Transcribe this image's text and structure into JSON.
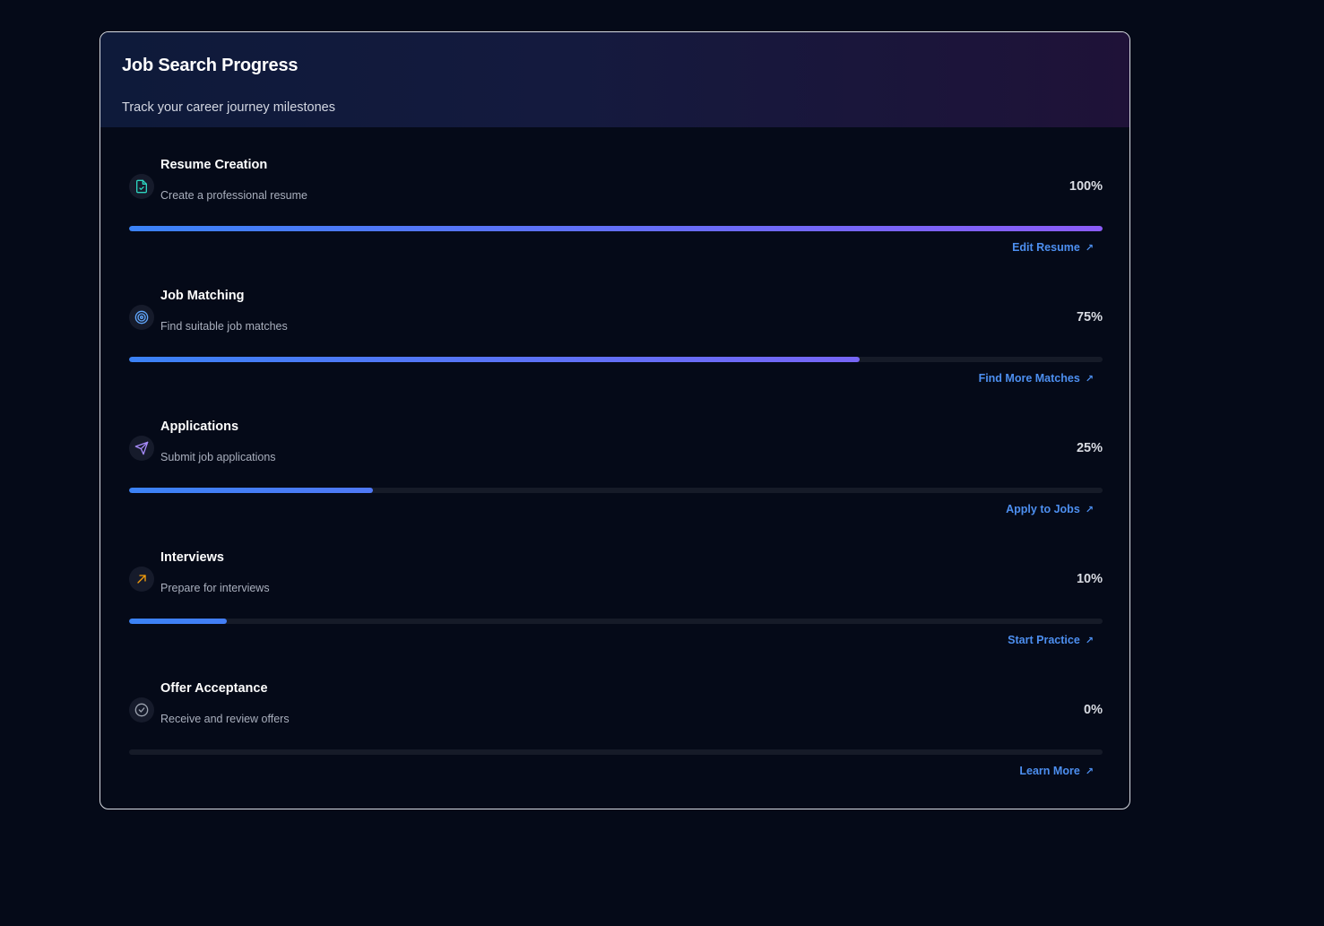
{
  "header": {
    "title": "Job Search Progress",
    "subtitle": "Track your career journey milestones"
  },
  "milestones": [
    {
      "title": "Resume Creation",
      "description": "Create a professional resume",
      "percent_label": "100%",
      "progress": 1.0,
      "action_label": "Edit Resume",
      "icon": "file-check-icon",
      "icon_color": "#2dd4bf"
    },
    {
      "title": "Job Matching",
      "description": "Find suitable job matches",
      "percent_label": "75%",
      "progress": 0.75,
      "action_label": "Find More Matches",
      "icon": "target-icon",
      "icon_color": "#60a5fa"
    },
    {
      "title": "Applications",
      "description": "Submit job applications",
      "percent_label": "25%",
      "progress": 0.25,
      "action_label": "Apply to Jobs",
      "icon": "send-icon",
      "icon_color": "#a78bfa"
    },
    {
      "title": "Interviews",
      "description": "Prepare for interviews",
      "percent_label": "10%",
      "progress": 0.1,
      "action_label": "Start Practice",
      "icon": "trending-up-arrow-icon",
      "icon_color": "#f59e0b"
    },
    {
      "title": "Offer Acceptance",
      "description": "Receive and review offers",
      "percent_label": "0%",
      "progress": 0.0,
      "action_label": "Learn More",
      "icon": "check-circle-icon",
      "icon_color": "#9ca3af"
    }
  ],
  "colors": {
    "progress_start": "#3b82f6",
    "progress_end": "#8b5cf6",
    "link": "#4d8ff0"
  }
}
